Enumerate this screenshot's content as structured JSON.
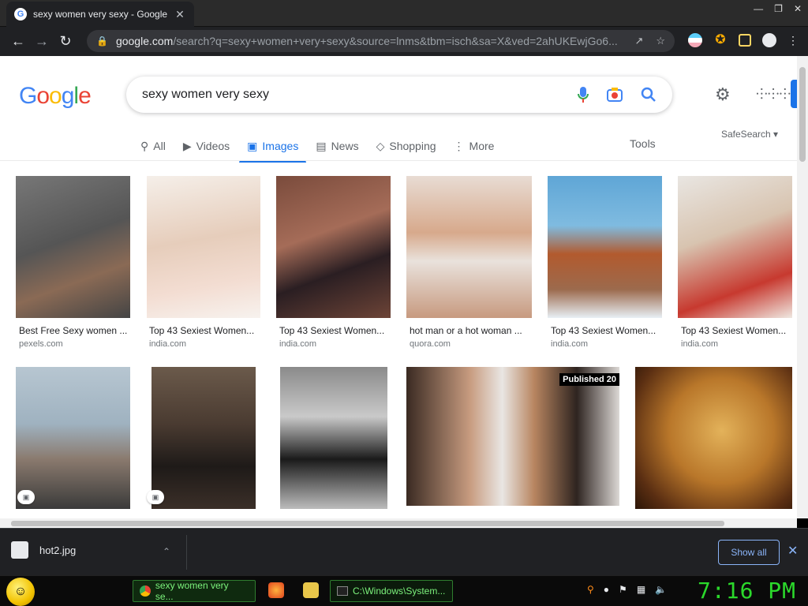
{
  "browser": {
    "tab_title": "sexy women very sexy - Google",
    "tab_close": "✕",
    "url_host": "google.com",
    "url_path": "/search?q=sexy+women+very+sexy&source=lnms&tbm=isch&sa=X&ved=2ahUKEwjGo6..."
  },
  "google": {
    "logo_letters": [
      "G",
      "o",
      "o",
      "g",
      "l",
      "e"
    ],
    "logo_colors": [
      "#4285f4",
      "#ea4335",
      "#fbbc05",
      "#4285f4",
      "#34a853",
      "#ea4335"
    ],
    "query": "sexy women very sexy",
    "tabs": [
      {
        "label": "All",
        "icon": "search-icon",
        "active": false
      },
      {
        "label": "Videos",
        "icon": "video-icon",
        "active": false
      },
      {
        "label": "Images",
        "icon": "image-icon",
        "active": true
      },
      {
        "label": "News",
        "icon": "news-icon",
        "active": false
      },
      {
        "label": "Shopping",
        "icon": "tag-icon",
        "active": false
      },
      {
        "label": "More",
        "icon": "more-vert-icon",
        "active": false
      }
    ],
    "tools_label": "Tools",
    "safesearch_label": "SafeSearch ▾"
  },
  "results_row1": [
    {
      "caption": "Best Free Sexy women ...",
      "source": "pexels.com"
    },
    {
      "caption": "Top 43 Sexiest Women...",
      "source": "india.com"
    },
    {
      "caption": "Top 43 Sexiest Women...",
      "source": "india.com"
    },
    {
      "caption": "hot man or a hot woman ...",
      "source": "quora.com"
    },
    {
      "caption": "Top 43 Sexiest Women...",
      "source": "india.com"
    },
    {
      "caption": "Top 43 Sexiest Women...",
      "source": "india.com"
    }
  ],
  "results_row2": [
    {
      "badge": "image-badge-icon"
    },
    {
      "badge": "image-badge-icon"
    },
    {},
    {
      "overlay": "Published 20"
    },
    {}
  ],
  "download": {
    "file_name": "hot2.jpg",
    "show_all": "Show all",
    "close": "✕"
  },
  "taskbar": {
    "chrome_task": "sexy women very se...",
    "cmd_task": "C:\\Windows\\System...",
    "clock": "7:16 PM"
  }
}
